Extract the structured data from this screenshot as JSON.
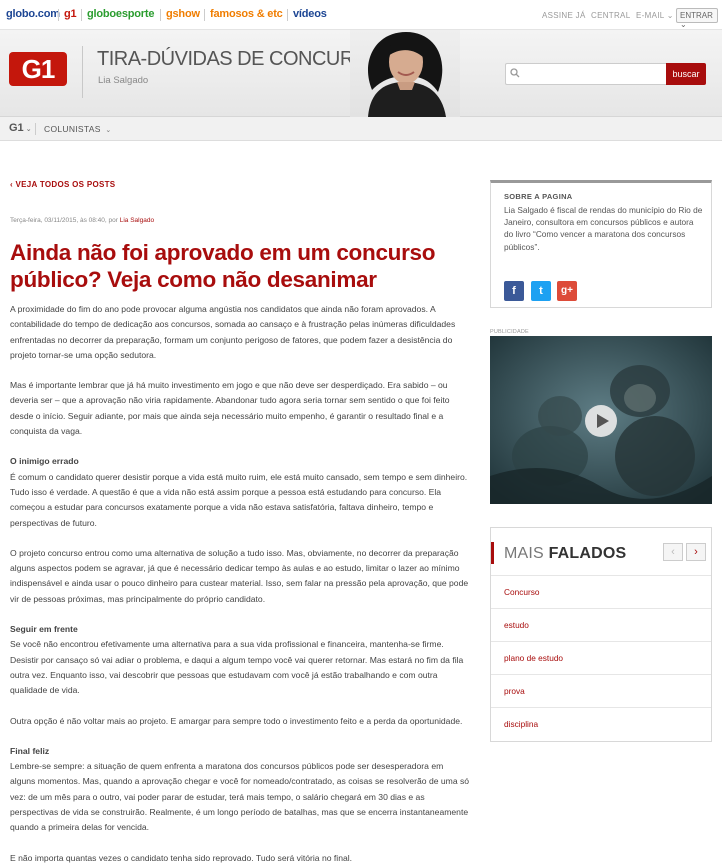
{
  "topbar": {
    "links": [
      {
        "label": "globo.com",
        "color": "#1c4593"
      },
      {
        "label": "g1",
        "color": "#c4170c"
      },
      {
        "label": "globoesporte",
        "color": "#2b9d2f"
      },
      {
        "label": "gshow",
        "color": "#f07d00"
      },
      {
        "label": "famosos & etc",
        "color": "#f07d00"
      },
      {
        "label": "vídeos",
        "color": "#1c4593"
      }
    ],
    "assine": "ASSINE JÁ",
    "central": "CENTRAL",
    "email": "E-MAIL",
    "entrar": "ENTRAR"
  },
  "header": {
    "logo": "G1",
    "blog_title": "TIRA-DÚVIDAS DE CONCURSOS",
    "author": "Lia Salgado",
    "search_placeholder": "",
    "search_button": "buscar"
  },
  "nav": {
    "g1": "G1",
    "colunistas": "COLUNISTAS"
  },
  "article": {
    "back_link": "VEJA TODOS OS POSTS",
    "meta_prefix": "Terça-feira, 03/11/2015, às 08:40, por",
    "meta_author": "Lia Salgado",
    "title": "Ainda não foi aprovado em um concurso público? Veja como não desanimar",
    "p1": "A proximidade do fim do ano pode provocar alguma angústia nos candidatos que ainda não foram aprovados. A contabilidade do tempo de dedicação aos concursos, somada ao cansaço e à frustração pelas inúmeras dificuldades enfrentadas no decorrer da preparação, formam um conjunto perigoso de fatores, que podem fazer a desistência do projeto tornar-se uma opção sedutora.",
    "p2": "Mas é importante lembrar que já há muito investimento em jogo e que não deve ser desperdiçado. Era sabido – ou deveria ser – que a aprovação não viria rapidamente. Abandonar tudo agora seria tornar sem sentido o que foi feito desde o início. Seguir adiante, por mais que ainda seja necessário muito empenho, é garantir o resultado final e a conquista da vaga.",
    "h1": "O inimigo errado",
    "p3": "É comum o candidato querer desistir porque a vida está muito ruim, ele está muito cansado, sem tempo e sem dinheiro. Tudo isso é verdade. A questão é que a vida não está assim porque a pessoa está estudando para concurso. Ela começou a estudar para concursos exatamente porque a vida não estava satisfatória, faltava dinheiro, tempo e perspectivas de futuro.",
    "p4": "O projeto concurso entrou como uma alternativa de solução a tudo isso. Mas, obviamente, no decorrer da preparação alguns aspectos podem se agravar, já que é necessário dedicar tempo às aulas e ao estudo, limitar o lazer ao mínimo indispensável e ainda usar o pouco dinheiro para custear material. Isso, sem falar na pressão pela aprovação, que pode vir de pessoas próximas, mas principalmente do próprio candidato.",
    "h2": "Seguir em frente",
    "p5": "Se você não encontrou efetivamente uma alternativa para a sua vida profissional e financeira, mantenha-se firme. Desistir por cansaço só vai adiar o problema, e daqui a algum tempo você vai querer retornar. Mas estará no fim da fila outra vez. Enquanto isso, vai descobrir que pessoas que estudavam com você já estão trabalhando e com outra qualidade de vida.",
    "p6": "Outra opção é não voltar mais ao projeto. E amargar para sempre todo o investimento feito e a perda da oportunidade.",
    "h3": "Final feliz",
    "p7": "Lembre-se sempre: a situação de quem enfrenta a maratona dos concursos públicos pode ser desesperadora em alguns momentos. Mas, quando a aprovação chegar e você for nomeado/contratado, as coisas se resolverão de uma só vez: de um mês para o outro, vai poder parar de estudar, terá mais tempo, o salário chegará em 30 dias e as perspectivas de vida se construirão. Realmente, é um longo período de batalhas, mas que se encerra instantaneamente quando a primeira delas for vencida.",
    "p8": "E não importa quantas vezes o candidato tenha sido reprovado. Tudo será vitória no final."
  },
  "sidebar": {
    "about_label": "SOBRE A PAGINA",
    "about_text": "Lia Salgado é fiscal de rendas do município do Rio de Janeiro, consultora em concursos públicos e autora do livro “Como vencer a maratona dos concursos públicos”.",
    "social": [
      {
        "icon": "facebook-icon",
        "glyph": "f",
        "color": "#3b5998"
      },
      {
        "icon": "twitter-icon",
        "glyph": "t",
        "color": "#1da1f2"
      },
      {
        "icon": "googleplus-icon",
        "glyph": "g+",
        "color": "#dd4b39"
      }
    ],
    "pub_label": "PUBLICIDADE",
    "falados_light": "MAIS",
    "falados_bold": "FALADOS",
    "falados_items": [
      "Concurso",
      "estudo",
      "plano de estudo",
      "prova",
      "disciplina"
    ]
  }
}
